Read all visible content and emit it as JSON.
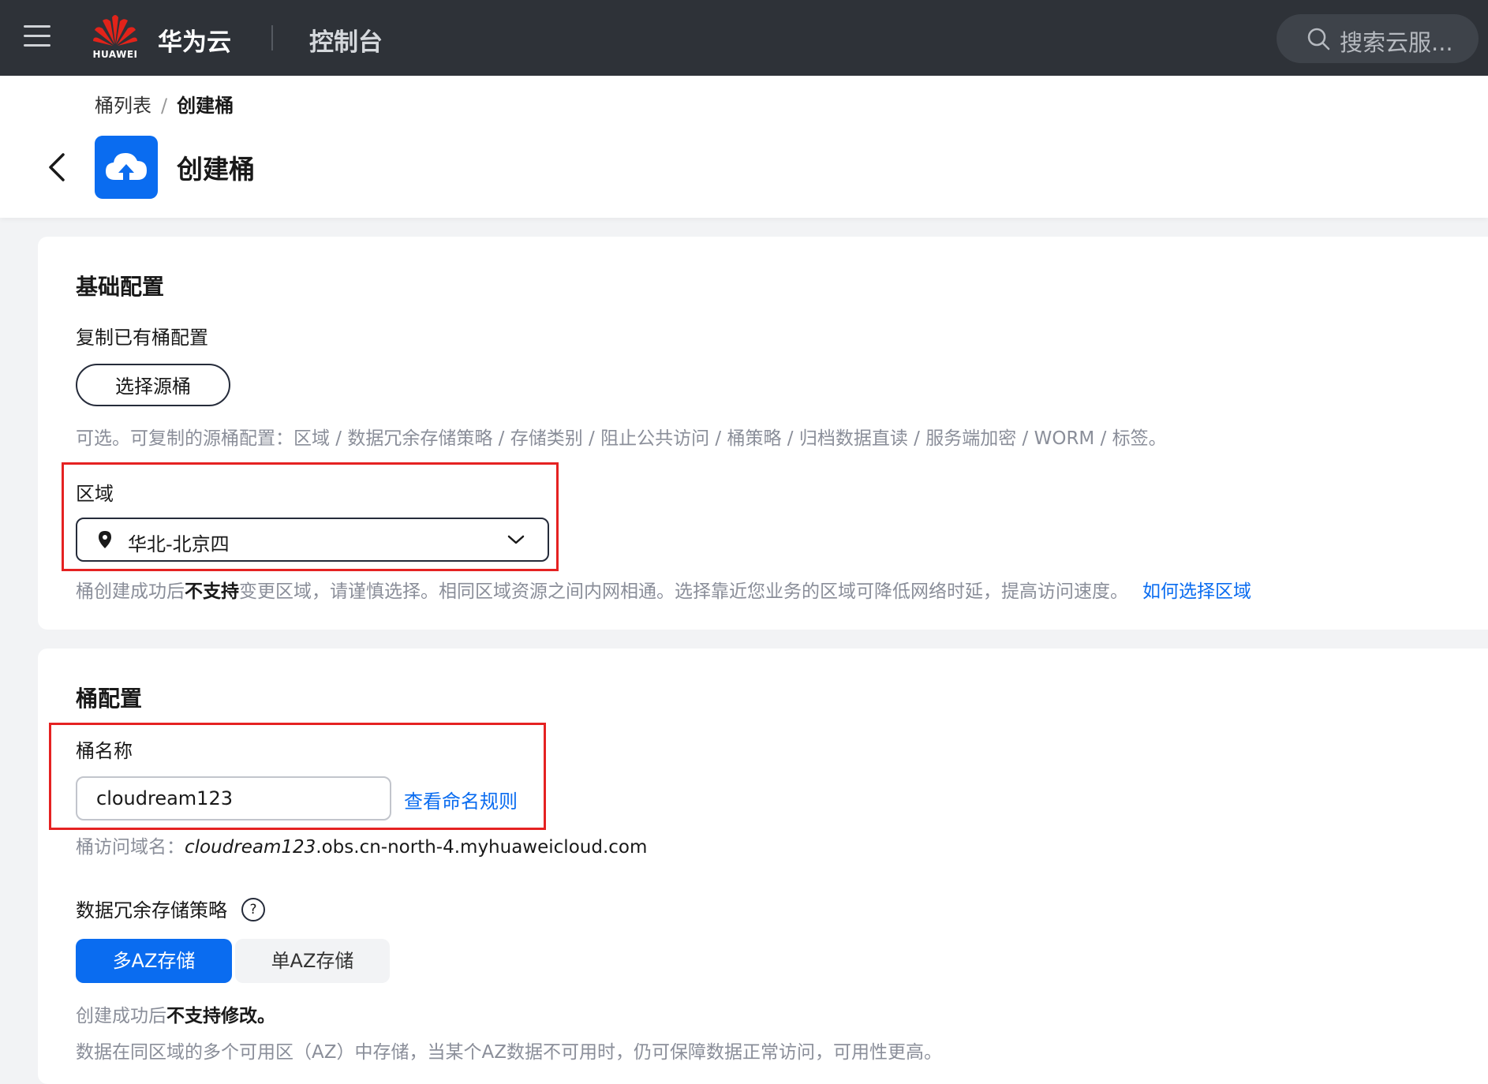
{
  "topbar": {
    "logo_text": "HUAWEI",
    "brand": "华为云",
    "console": "控制台",
    "search_placeholder": "搜索云服..."
  },
  "breadcrumb": {
    "parent": "桶列表",
    "separator": "/",
    "current": "创建桶"
  },
  "page": {
    "title": "创建桶"
  },
  "basic": {
    "section_title": "基础配置",
    "copy_label": "复制已有桶配置",
    "select_source_button": "选择源桶",
    "copy_hint": "可选。可复制的源桶配置：区域 / 数据冗余存储策略 / 存储类别 / 阻止公共访问 / 桶策略 / 归档数据直读 / 服务端加密 / WORM / 标签。",
    "region_label": "区域",
    "region_value": "华北-北京四",
    "region_hint_prefix": "桶创建成功后",
    "region_hint_bold": "不支持",
    "region_hint_suffix": "变更区域，请谨慎选择。相同区域资源之间内网相通。选择靠近您业务的区域可降低网络时延，提高访问速度。",
    "region_help_link": "如何选择区域"
  },
  "bucket": {
    "section_title": "桶配置",
    "name_label": "桶名称",
    "name_value": "cloudream123",
    "name_rule_link": "查看命名规则",
    "domain_label": "桶访问域名：",
    "domain_name_part": "cloudream123",
    "domain_suffix": ".obs.cn-north-4.myhuaweicloud.com",
    "redundancy_label": "数据冗余存储策略",
    "help_glyph": "?",
    "options": [
      "多AZ存储",
      "单AZ存储"
    ],
    "selected_option": "多AZ存储",
    "note_prefix": "创建成功后",
    "note_bold": "不支持修改。",
    "description": "数据在同区域的多个可用区（AZ）中存储，当某个AZ数据不可用时，仍可保障数据正常访问，可用性更高。"
  },
  "colors": {
    "topbar_bg": "#2e3238",
    "accent": "#0a6cf0",
    "highlight": "#e52222",
    "page_bg": "#f2f3f5"
  }
}
